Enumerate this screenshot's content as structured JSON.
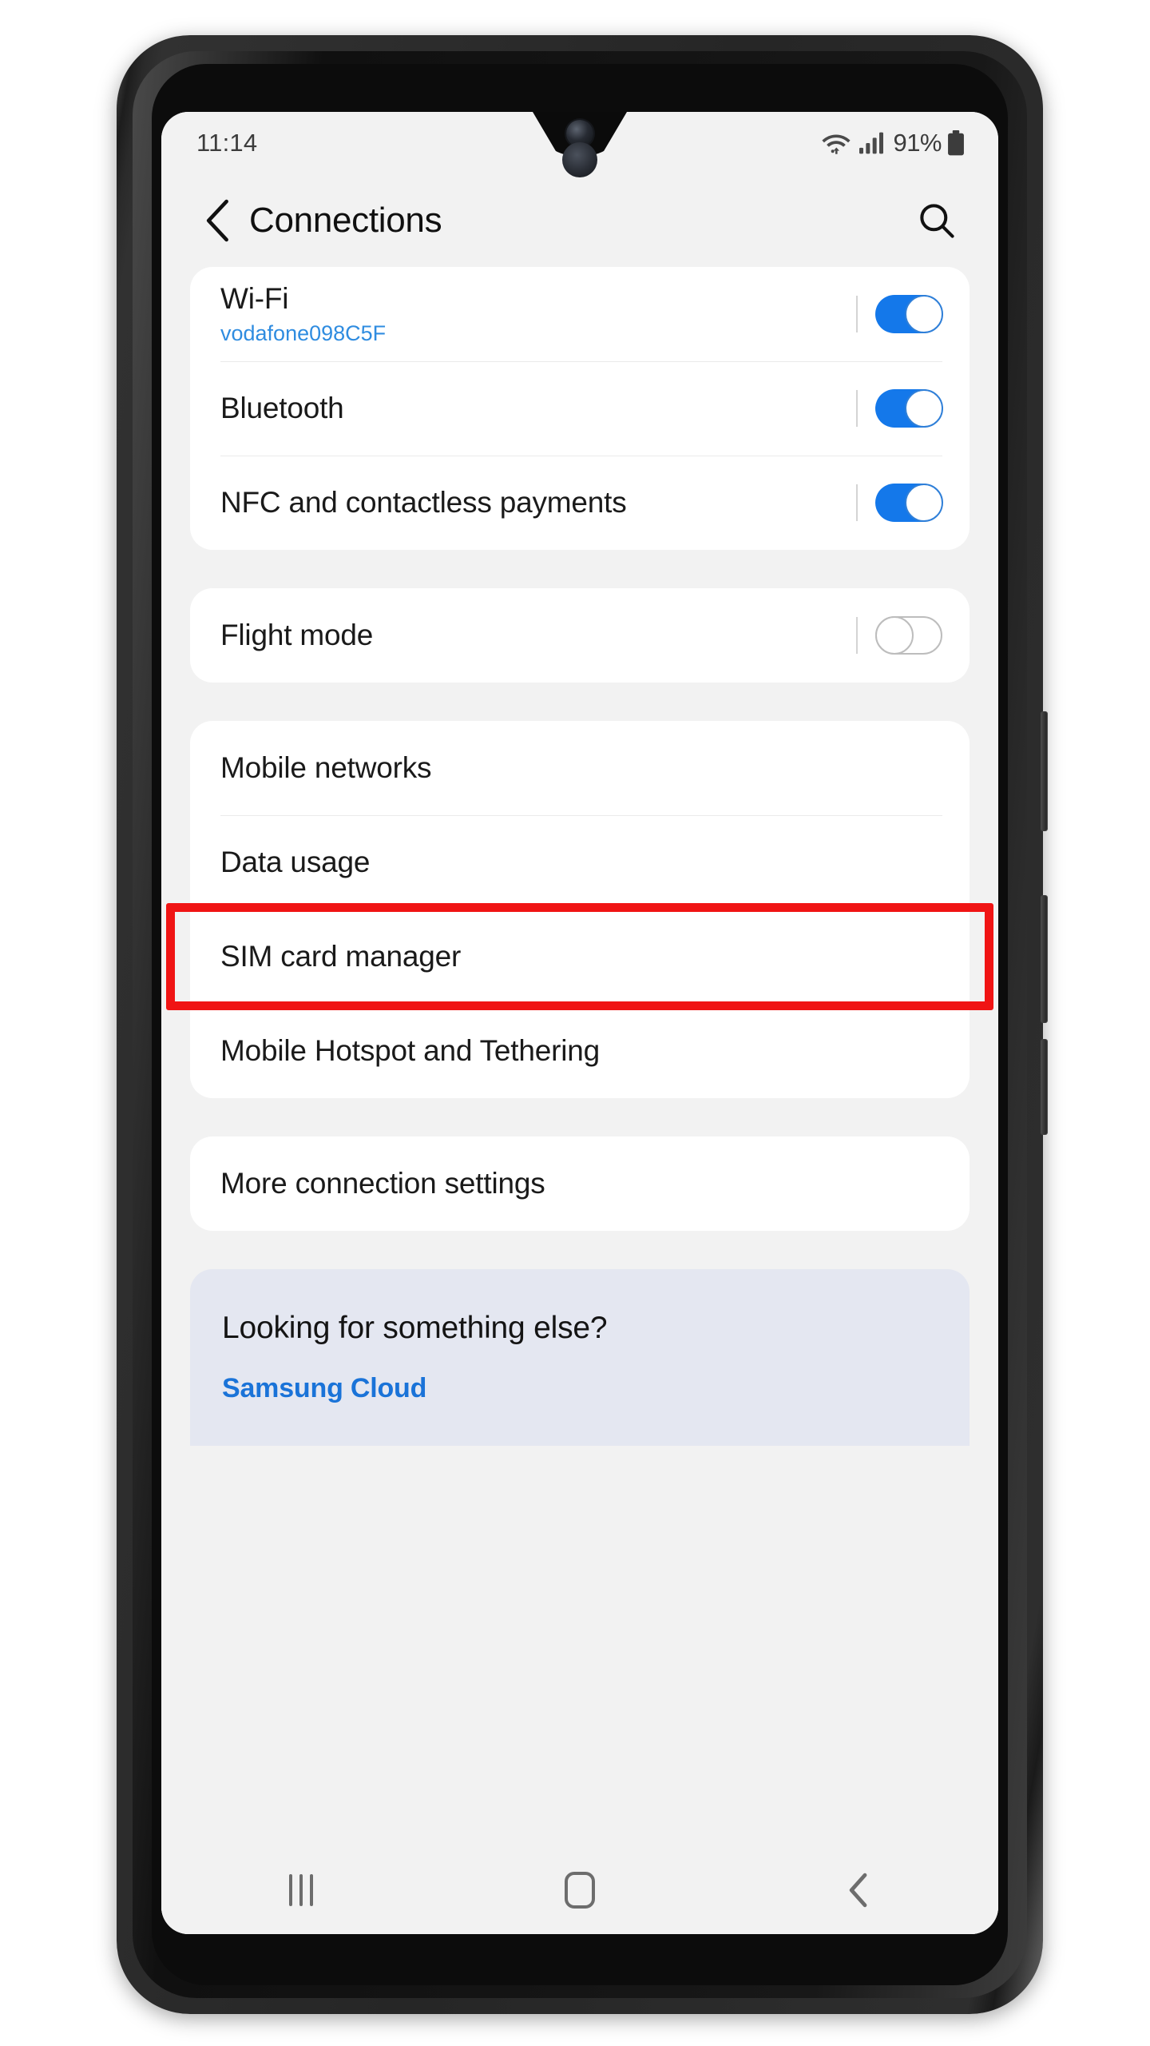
{
  "status_bar": {
    "time": "11:14",
    "battery_percent": "91%",
    "icons": [
      "wifi-icon",
      "signal-icon",
      "battery-icon"
    ]
  },
  "app_bar": {
    "back_label": "Back",
    "title": "Connections",
    "search_label": "Search"
  },
  "groups": [
    {
      "rows": [
        {
          "title": "Wi-Fi",
          "subtitle": "vodafone098C5F",
          "control": "toggle",
          "state": "on"
        },
        {
          "title": "Bluetooth",
          "subtitle": "",
          "control": "toggle",
          "state": "on"
        },
        {
          "title": "NFC and contactless payments",
          "subtitle": "",
          "control": "toggle",
          "state": "on"
        }
      ]
    },
    {
      "rows": [
        {
          "title": "Flight mode",
          "subtitle": "",
          "control": "toggle",
          "state": "off"
        }
      ]
    },
    {
      "rows": [
        {
          "title": "Mobile networks",
          "subtitle": "",
          "control": "none",
          "state": ""
        },
        {
          "title": "Data usage",
          "subtitle": "",
          "control": "none",
          "state": ""
        },
        {
          "title": "SIM card manager",
          "subtitle": "",
          "control": "none",
          "state": ""
        },
        {
          "title": "Mobile Hotspot and Tethering",
          "subtitle": "",
          "control": "none",
          "state": ""
        }
      ]
    },
    {
      "rows": [
        {
          "title": "More connection settings",
          "subtitle": "",
          "control": "none",
          "state": ""
        }
      ]
    }
  ],
  "promo": {
    "title": "Looking for something else?",
    "link": "Samsung Cloud"
  },
  "annotation": {
    "target": "SIM card manager",
    "color": "#f01414",
    "shape": "rectangle"
  },
  "nav_bar": {
    "recents_label": "Recents",
    "home_label": "Home",
    "back_label": "Back"
  },
  "colors": {
    "accent_blue": "#1478ea",
    "link_blue": "#1a73d8",
    "subtitle_blue": "#2f8ce0",
    "page_bg": "#f2f2f2",
    "card_bg": "#ffffff",
    "promo_bg": "#e4e7f1",
    "annotation_red": "#f01414"
  }
}
